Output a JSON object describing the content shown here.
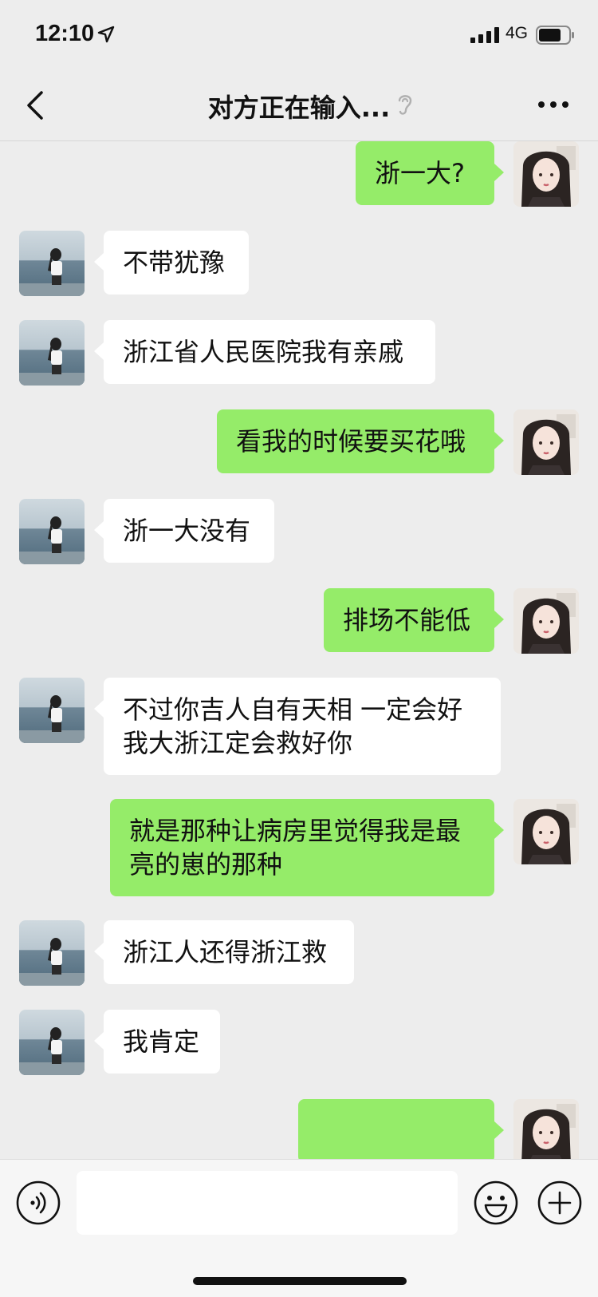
{
  "status_bar": {
    "time": "12:10",
    "network": "4G",
    "battery_level": 0.75
  },
  "nav": {
    "title": "对方正在输入..."
  },
  "messages": [
    {
      "side": "right",
      "text": "浙一大?"
    },
    {
      "side": "left",
      "text": "不带犹豫"
    },
    {
      "side": "left",
      "text": "浙江省人民医院我有亲戚"
    },
    {
      "side": "right",
      "text": "看我的时候要买花哦"
    },
    {
      "side": "left",
      "text": "浙一大没有"
    },
    {
      "side": "right",
      "text": "排场不能低"
    },
    {
      "side": "left",
      "text": "不过你吉人自有天相 一定会好\n我大浙江定会救好你"
    },
    {
      "side": "right",
      "text": "就是那种让病房里觉得我是最\n亮的崽的那种"
    },
    {
      "side": "left",
      "text": "浙江人还得浙江救"
    },
    {
      "side": "left",
      "text": "我肯定"
    },
    {
      "side": "right",
      "text": ""
    }
  ],
  "input": {
    "value": ""
  },
  "colors": {
    "background": "#ededed",
    "self_bubble": "#95ec69",
    "other_bubble": "#ffffff"
  },
  "icons": [
    "location-arrow-icon",
    "signal-icon",
    "battery-icon",
    "back-chevron-icon",
    "ear-icon",
    "more-dots-icon",
    "voice-icon",
    "emoji-icon",
    "plus-icon"
  ]
}
